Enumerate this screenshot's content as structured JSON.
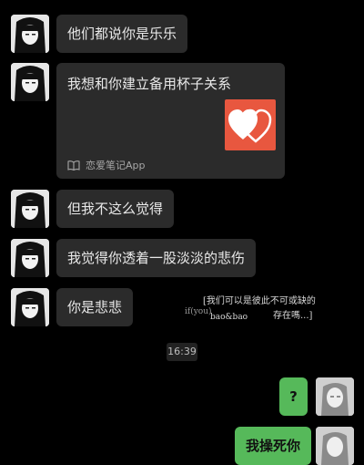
{
  "messages": [
    {
      "text": "他们都说你是乐乐"
    },
    {
      "title": "我想和你建立备用杯子关系",
      "source": "恋爱笔记App",
      "thumb_icon": "two-hearts-icon"
    },
    {
      "text": "但我不这么觉得"
    },
    {
      "text": "我觉得你透着一股淡淡的悲伤"
    },
    {
      "text": "你是悲悲"
    },
    {
      "text": "?"
    },
    {
      "text": "我操死你"
    }
  ],
  "timestamp": "16:39",
  "overlay": {
    "line1": "[我们可以是彼此不可或缺的",
    "line2": "if(you)",
    "line3": "bao&bao",
    "line4": "存在嗎...]"
  },
  "colors": {
    "background": "#000000",
    "bubble": "#2b2b2b",
    "sent_bubble": "#56b95a",
    "card_thumb": "#e8573f"
  }
}
